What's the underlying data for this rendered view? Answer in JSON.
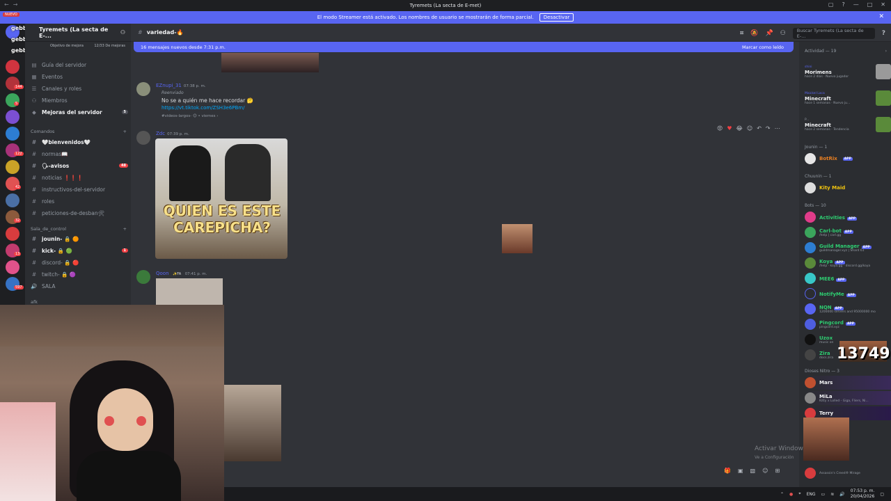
{
  "window": {
    "title": "Tyremets (La secta de E-met)"
  },
  "streamer_bar": {
    "text": "El modo Streamer está activado. Los nombres de usuario se mostrarán de forma parcial.",
    "button": "Desactivar"
  },
  "server": {
    "name": "Tyremets (La secta de E-...",
    "boost_label": "Objetivo de mejora",
    "boost_count": "12/33 De mejoras"
  },
  "overlay_names": [
    "NUEVO",
    "gebbb08 :",
    "gebbb08 :",
    "gebbb08 :"
  ],
  "top_items": [
    {
      "label": "Guía del servidor"
    },
    {
      "label": "Eventos"
    },
    {
      "label": "Canales y roles"
    },
    {
      "label": "Miembros"
    },
    {
      "label": "Mejoras del servidor",
      "badge": "5"
    }
  ],
  "categories": {
    "comandos": "Comandos",
    "sala": "Sala_de_control",
    "afk": "afk"
  },
  "channels": [
    {
      "label": "🤍bienvenidos🤍"
    },
    {
      "label": "normas📖"
    },
    {
      "label": "🗣-avisos",
      "badge": "48"
    },
    {
      "label": "noticias ❗❗❗"
    },
    {
      "label": "instructivos-del-servidor"
    },
    {
      "label": "roles"
    },
    {
      "label": "peticiones-de-desban🛠"
    }
  ],
  "sala_channels": [
    {
      "label": "jounin- 🔒 🟠"
    },
    {
      "label": "kick- 🔒 🟢",
      "badge": "1"
    },
    {
      "label": "discord- 🔒 🔴"
    },
    {
      "label": "twitch- 🔒 🟣"
    },
    {
      "label": "SALA"
    }
  ],
  "guild_badges": [
    "144",
    "5",
    "122",
    "42",
    "32",
    "13",
    "597"
  ],
  "channel_header": {
    "name": "variedad-🔥",
    "search_placeholder": "Buscar Tyremets (La secta de E-..."
  },
  "new_messages": {
    "text": "16 mensajes nuevos desde 7:31 p.m.",
    "action": "Marcar como leído"
  },
  "messages": [
    {
      "user": "EZnupi_31",
      "time": "07:38 p. m.",
      "forwarded": "Reenviado",
      "text": "No se a quién me hace recordar 🤔",
      "link": "https://vt.tiktok.com/ZSH3e6PBm/",
      "meta": "#videos-largos- 😊 • viernes ›"
    },
    {
      "user": "Zdc",
      "time": "07:39 p. m.",
      "image_caption": "QUIEN ES ESTE CAREPICHA?"
    },
    {
      "user": "Qoon",
      "tag": "✨FA",
      "time": "07:41 p. m."
    }
  ],
  "members": {
    "activity_header": "Actividad — 19",
    "activities": [
      {
        "top": "shini",
        "name": "Morimens",
        "sub": "hace 2 días · Nuevo jugador"
      },
      {
        "top": "Maickel Laca",
        "name": "Minecraft",
        "sub": "hace 1 semanas · Nuevo ju..."
      },
      {
        "top": "P...",
        "name": "Minecraft",
        "sub": "hace 2 semanas · Tendencia"
      }
    ],
    "jounin_header": "Jounin — 1",
    "jounin": [
      {
        "name": "BotRix",
        "app": "APP"
      }
    ],
    "chuunin_header": "Chuunin — 1",
    "chuunin": [
      {
        "name": "Kity Maid"
      }
    ],
    "bots_header": "Bots — 10",
    "bots": [
      {
        "name": "Activities",
        "app": "APP",
        "sub": ""
      },
      {
        "name": "Carl-bot",
        "app": "APP",
        "sub": "/help | carl.gg"
      },
      {
        "name": "Guild Manager",
        "app": "APP",
        "sub": "guildmanager.xyz | Shard 61"
      },
      {
        "name": "Koya",
        "app": "APP",
        "sub": "/help · koya.gg · discord.gg/koya"
      },
      {
        "name": "MEE6",
        "app": "APP",
        "sub": ""
      },
      {
        "name": "NotifyMe",
        "app": "APP",
        "sub": ""
      },
      {
        "name": "NQN",
        "app": "APP",
        "sub": "1200000 servers and 95000000 mo"
      },
      {
        "name": "Pingcord",
        "app": "APP",
        "sub": "pingcord.xyz"
      },
      {
        "name": "Uzox",
        "app": "",
        "sub": "music on"
      },
      {
        "name": "Zira",
        "app": "",
        "sub": "docs.zira"
      }
    ],
    "nitro_header": "Dioses Nitro — 3",
    "nitro": [
      {
        "name": "Mars",
        "sub": ""
      },
      {
        "name": "MiLa",
        "sub": "Kitty x Lolled - Giga, Fliers, Ni..."
      },
      {
        "name": "Terry",
        "sub": ""
      }
    ],
    "overlay_number": "13749",
    "last_sub": "Assassin's Creed® Mirage"
  },
  "watermark": {
    "line1": "Activar Window",
    "line2": "Ve a Configuración"
  },
  "taskbar": {
    "lang": "ENG",
    "time": "07:53 p. m.",
    "date": "20/04/2026"
  },
  "colors": {
    "accent": "#5865f2",
    "bg": "#313338",
    "sidebar": "#2b2d31",
    "guilds": "#1e1f22"
  }
}
